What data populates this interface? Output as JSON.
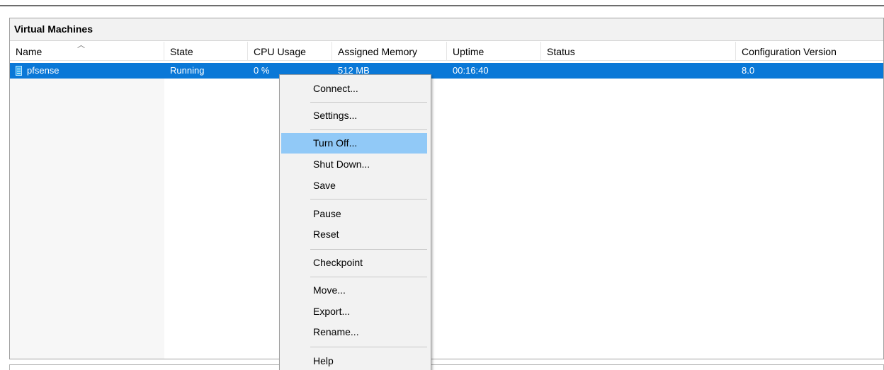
{
  "panel": {
    "title": "Virtual Machines"
  },
  "columns": [
    "Name",
    "State",
    "CPU Usage",
    "Assigned Memory",
    "Uptime",
    "Status",
    "Configuration Version"
  ],
  "sort_indicator": "^",
  "rows": [
    {
      "name": "pfsense",
      "state": "Running",
      "cpu": "0 %",
      "memory": "512 MB",
      "uptime": "00:16:40",
      "status": "",
      "config_version": "8.0",
      "icon": "vm-icon",
      "selected": true
    }
  ],
  "context_menu": {
    "items": [
      "Connect...",
      "Settings...",
      "Turn Off...",
      "Shut Down...",
      "Save",
      "Pause",
      "Reset",
      "Checkpoint",
      "Move...",
      "Export...",
      "Rename...",
      "Help"
    ],
    "highlighted": "Turn Off..."
  },
  "colors": {
    "selection": "#0a78d7",
    "menu_hover": "#91c9f7",
    "menu_bg": "#f2f2f2"
  }
}
